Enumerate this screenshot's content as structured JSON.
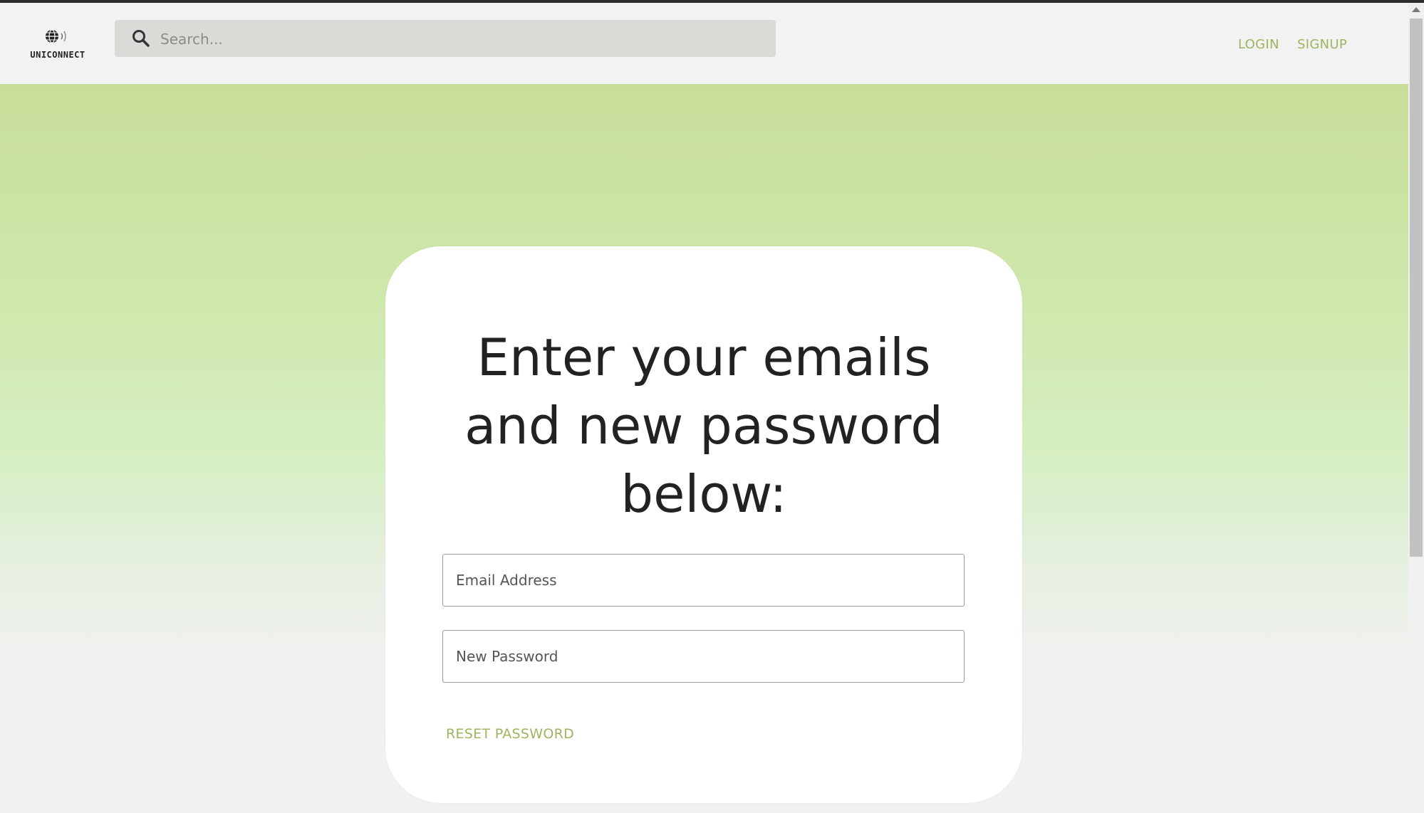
{
  "header": {
    "logo_text": "UNICONNECT",
    "search_placeholder": "Search...",
    "nav": {
      "login": "LOGIN",
      "signup": "SIGNUP"
    }
  },
  "reset_form": {
    "title": "Enter your emails and new password below:",
    "email_placeholder": "Email Address",
    "password_placeholder": "New Password",
    "reset_label": "RESET PASSWORD"
  },
  "colors": {
    "accent": "#9cb55f",
    "gradient_top": "#c9dd9a",
    "gradient_bottom": "#f1f1f1"
  }
}
